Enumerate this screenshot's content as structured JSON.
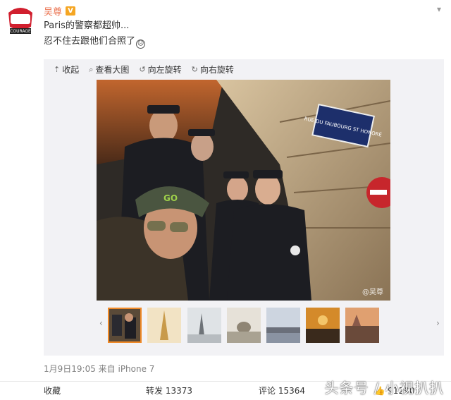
{
  "post": {
    "username": "吴尊",
    "vip_badge": "V",
    "text_line1": "Paris的警察都超帅...",
    "text_line2": "忍不住去跟他们合照了",
    "emoji": "☹"
  },
  "toolbar": {
    "collapse": "收起",
    "view_large": "查看大图",
    "rotate_left": "向左旋转",
    "rotate_right": "向右旋转"
  },
  "photo": {
    "street_sign": "RUE DU FAUBOURG ST HONORÉ",
    "cap_text": "GO",
    "watermark": "@吴尊"
  },
  "meta": {
    "time_source": "1月9日19:05 来自 iPhone 7"
  },
  "actions": {
    "favorite": "收藏",
    "repost": "转发 13373",
    "comment": "评论 15364",
    "like_count": "91290"
  },
  "overlay_logo": "头条号 / 小视扒扒",
  "avatar_text": "COURAGE",
  "colors": {
    "username": "#eb7350",
    "thumb_active": "#f08a28",
    "media_bg": "#f2f2f5"
  },
  "thumbnails": [
    {
      "name": "police-selfie"
    },
    {
      "name": "eiffel-tower-gold"
    },
    {
      "name": "eiffel-tower-gray"
    },
    {
      "name": "invalides-dome"
    },
    {
      "name": "louvre-bridge"
    },
    {
      "name": "night-street"
    },
    {
      "name": "city-sunset"
    }
  ]
}
